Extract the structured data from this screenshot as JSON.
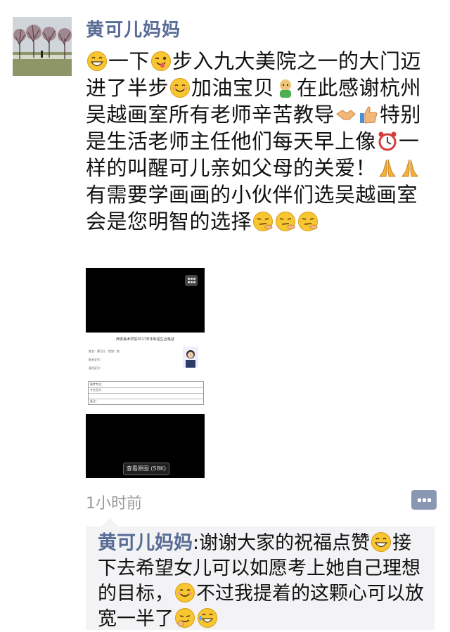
{
  "post": {
    "author": "黄可儿妈妈",
    "segments": [
      {
        "emoji": "grin-icon"
      },
      {
        "text": "一下"
      },
      {
        "emoji": "wink-tongue-icon"
      },
      {
        "text": "步入九大美院之一的大门迈进了半步"
      },
      {
        "emoji": "smile-icon"
      },
      {
        "text": "加油宝贝"
      },
      {
        "emoji": "kid-icon"
      },
      {
        "text": "在此感谢杭州吴越画室所有老师辛苦教导"
      },
      {
        "emoji": "handshake-icon"
      },
      {
        "emoji": "thumbs-up-icon"
      },
      {
        "text": "特别是生活老师主任他们每天早上像"
      },
      {
        "emoji": "alarm-clock-icon"
      },
      {
        "text": "一样的叫醒可儿亲如父母的关爱！"
      },
      {
        "emoji": "pray-icon"
      },
      {
        "emoji": "pray-icon"
      },
      {
        "text": "有需要学画画的小伙伴们选吴越画室会是您明智的选择"
      },
      {
        "emoji": "thinking-icon"
      },
      {
        "emoji": "thinking-icon"
      },
      {
        "emoji": "thinking-icon"
      }
    ],
    "image": {
      "doc_title": "西安美术学院2017年本科招生合格证",
      "fields": [
        "姓名：黄可儿　性别：女",
        "报名证号：",
        "身份证号：",
        "报考专业：",
        "专业总分：",
        "备注："
      ],
      "view_original_label": "查看原图 (58K)"
    },
    "time": "1小时前"
  },
  "comment": {
    "author": "黄可儿妈妈",
    "separator": ":",
    "segments": [
      {
        "text": "谢谢大家的祝福点赞"
      },
      {
        "emoji": "grin-icon"
      },
      {
        "text": "接下去希望女儿可以如愿考上她自己理想的目标，"
      },
      {
        "emoji": "smile-icon"
      },
      {
        "text": "不过我提着的这颗心可以放宽一半了"
      },
      {
        "emoji": "sly-icon"
      },
      {
        "emoji": "crying-laugh-icon"
      }
    ]
  },
  "colors": {
    "link": "#576b95",
    "time": "#9a9a9a",
    "comment_bg": "#f3f3f5",
    "emoji_yellow": "#f7c631"
  }
}
